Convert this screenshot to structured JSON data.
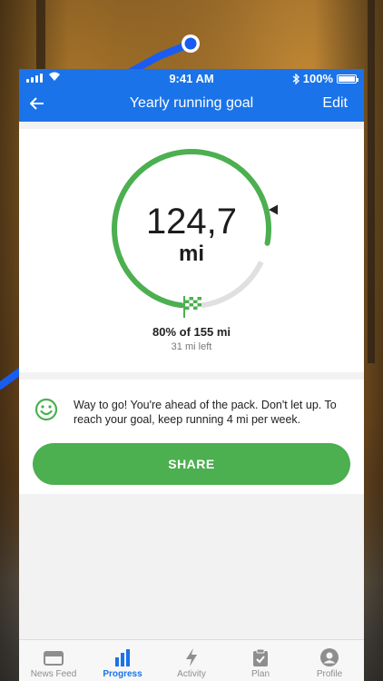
{
  "status_bar": {
    "time": "9:41 AM",
    "battery": "100%"
  },
  "nav": {
    "title": "Yearly running goal",
    "edit_label": "Edit"
  },
  "goal": {
    "distance": "124,7",
    "unit": "mi",
    "progress_fraction": 0.8,
    "percent_text": "80% of 155 mi",
    "remaining_text": "31 mi left"
  },
  "message": {
    "text": "Way to go! You're ahead of the pack. Don't let up. To reach your goal, keep running 4 mi per week."
  },
  "share_label": "SHARE",
  "tabs": [
    {
      "label": "News Feed",
      "icon": "news-feed-icon",
      "active": false
    },
    {
      "label": "Progress",
      "icon": "bar-chart-icon",
      "active": true
    },
    {
      "label": "Activity",
      "icon": "lightning-icon",
      "active": false
    },
    {
      "label": "Plan",
      "icon": "clipboard-icon",
      "active": false
    },
    {
      "label": "Profile",
      "icon": "profile-icon",
      "active": false
    }
  ],
  "colors": {
    "accent": "#1a73e8",
    "progress": "#4caf50",
    "track": "#e0e0e0"
  }
}
